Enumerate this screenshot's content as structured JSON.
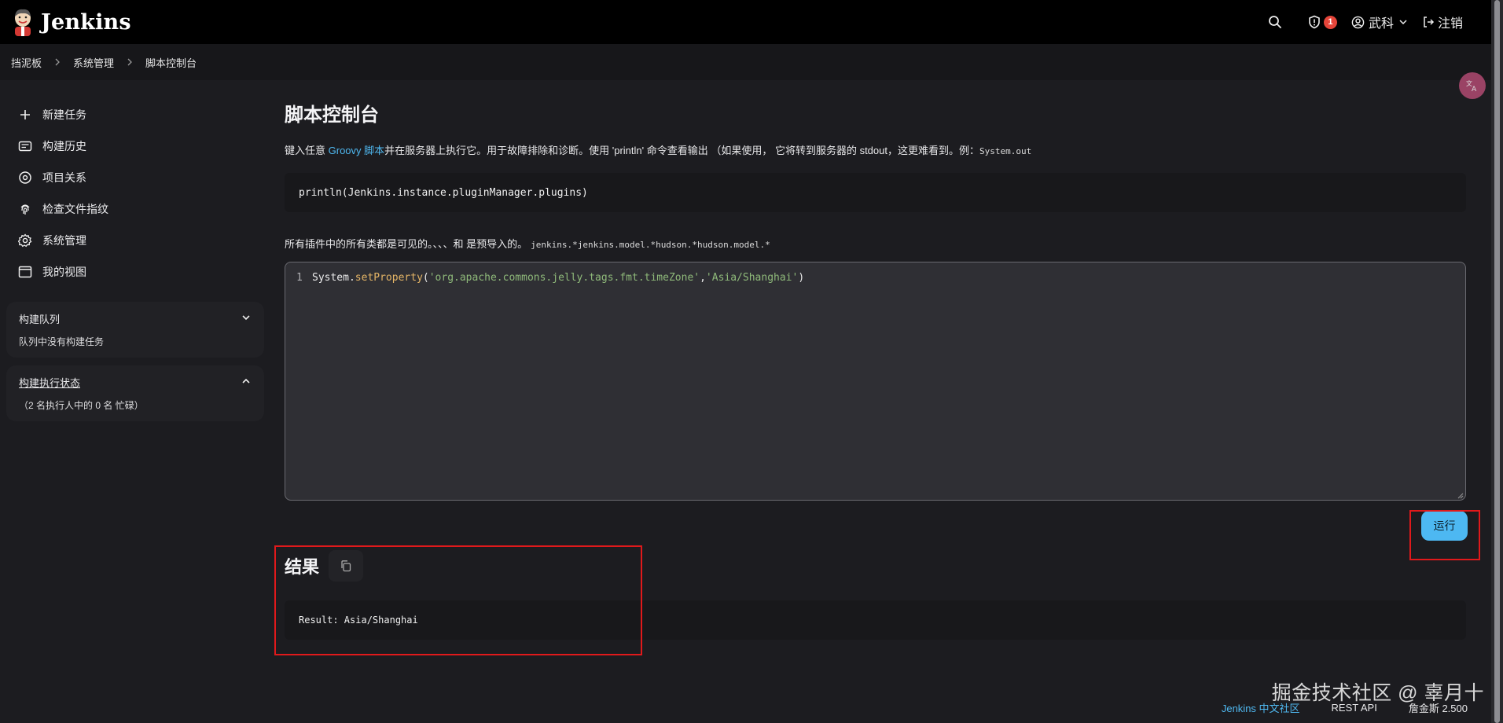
{
  "app": {
    "name": "Jenkins"
  },
  "header": {
    "alert_count": "1",
    "user_name": "武科",
    "logout_label": "注销"
  },
  "breadcrumb": [
    "挡泥板",
    "系统管理",
    "脚本控制台"
  ],
  "sidebar": {
    "items": [
      {
        "label": "新建任务",
        "icon": "plus-icon"
      },
      {
        "label": "构建历史",
        "icon": "history-icon"
      },
      {
        "label": "项目关系",
        "icon": "relationship-icon"
      },
      {
        "label": "检查文件指纹",
        "icon": "fingerprint-icon"
      },
      {
        "label": "系统管理",
        "icon": "gear-icon"
      },
      {
        "label": "我的视图",
        "icon": "window-icon"
      }
    ],
    "build_queue": {
      "title": "构建队列",
      "body": "队列中没有构建任务"
    },
    "executor_status": {
      "title": "构建执行状态",
      "body": "（2 名执行人中的 0 名 忙碌）"
    }
  },
  "main": {
    "title": "脚本控制台",
    "desc_prefix": "键入任意 ",
    "desc_link": "Groovy 脚本",
    "desc_suffix": "并在服务器上执行它。用于故障排除和诊断。使用 'println' 命令查看输出 （如果使用， 它将转到服务器的 stdout，这更难看到。例：",
    "desc_code": "System.out",
    "example_code": "println(Jenkins.instance.pluginManager.plugins)",
    "imports_text": "所有插件中的所有类都是可见的。、、、和 是预导入的。",
    "imports_code": "jenkins.*jenkins.model.*hudson.*hudson.model.*",
    "editor": {
      "line_number": "1",
      "tok1": "System.",
      "tok2": "setProperty",
      "tok3": "(",
      "tok4": "'org.apache.commons.jelly.tags.fmt.timeZone'",
      "tok5": ",",
      "tok6": "'Asia/Shanghai'",
      "tok7": ")"
    },
    "run_label": "运行",
    "result_title": "结果",
    "result_text": "Result: Asia/Shanghai"
  },
  "footer": {
    "community_link": "Jenkins 中文社区",
    "rest_api": "REST API",
    "version": "詹金斯 2.500"
  },
  "watermark": "掘金技术社区 @ 辜月十",
  "colors": {
    "accent": "#4db8f2",
    "header_bg": "#000000",
    "page_bg": "#1c1c20",
    "highlight": "#e0191b"
  }
}
